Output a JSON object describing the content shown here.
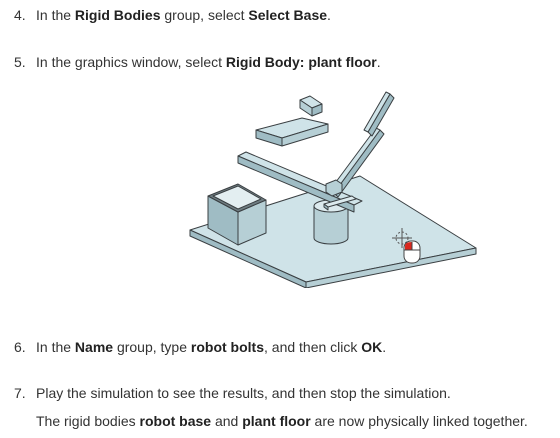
{
  "steps": [
    {
      "number": "4.",
      "parts": [
        {
          "text": "In the ",
          "bold": false
        },
        {
          "text": "Rigid Bodies",
          "bold": true
        },
        {
          "text": " group, select ",
          "bold": false
        },
        {
          "text": "Select Base",
          "bold": true
        },
        {
          "text": ".",
          "bold": false
        }
      ]
    },
    {
      "number": "5.",
      "parts": [
        {
          "text": "In the graphics window, select ",
          "bold": false
        },
        {
          "text": "Rigid Body: plant floor",
          "bold": true
        },
        {
          "text": ".",
          "bold": false
        }
      ]
    },
    {
      "number": "6.",
      "parts": [
        {
          "text": "In the ",
          "bold": false
        },
        {
          "text": "Name",
          "bold": true
        },
        {
          "text": " group, type ",
          "bold": false
        },
        {
          "text": "robot bolts",
          "bold": true
        },
        {
          "text": ", and then click ",
          "bold": false
        },
        {
          "text": "OK",
          "bold": true
        },
        {
          "text": ".",
          "bold": false
        }
      ]
    },
    {
      "number": "7.",
      "parts": [
        {
          "text": "Play the simulation to see the results, and then stop the simulation.",
          "bold": false
        }
      ]
    }
  ],
  "note": {
    "parts": [
      {
        "text": "The rigid bodies ",
        "bold": false
      },
      {
        "text": "robot base",
        "bold": true
      },
      {
        "text": " and ",
        "bold": false
      },
      {
        "text": "plant floor",
        "bold": true
      },
      {
        "text": " are now physically linked together.",
        "bold": false
      }
    ]
  },
  "colors": {
    "text": "#333333",
    "part_fill": "#cfe3e8",
    "part_side": "#9fbcc4",
    "edge": "#3a3f42",
    "cursor_red": "#d9281f"
  },
  "figure": {
    "icon": "mouse-select-cursor-icon"
  }
}
